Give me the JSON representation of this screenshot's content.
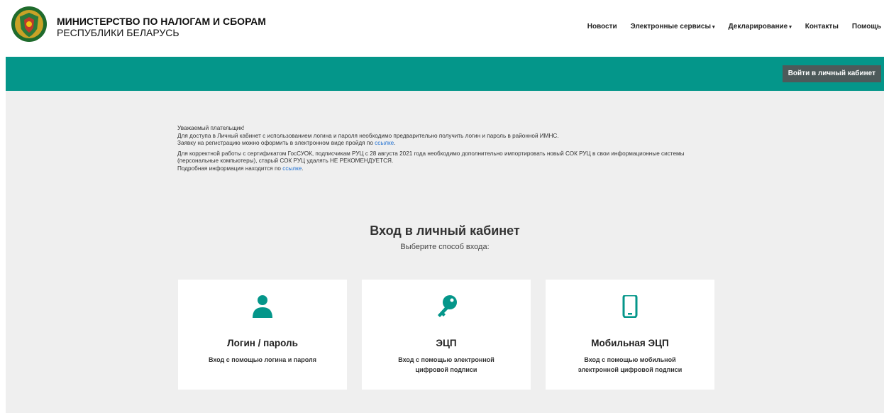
{
  "header": {
    "org_line1": "МИНИСТЕРСТВО ПО НАЛОГАМ И СБОРАМ",
    "org_line2": "РЕСПУБЛИКИ БЕЛАРУСЬ",
    "nav": [
      {
        "label": "Новости"
      },
      {
        "label": "Электронные сервисы",
        "dropdown": "▾"
      },
      {
        "label": "Декларирование",
        "dropdown": "▾"
      },
      {
        "label": "Контакты"
      },
      {
        "label": "Помощь"
      }
    ]
  },
  "banner": {
    "login_button": "Войти в личный кабинет",
    "color": "#04968a"
  },
  "notice": {
    "greeting": "Уважаемый плательщик!",
    "line1": "Для доступа в Личный кабинет с использованием логина и пароля необходимо предварительно получить логин и пароль в районной ИМНС.",
    "line2_prefix": "Заявку на регистрацию можно оформить в электронном виде пройдя по ",
    "link1": "ссылке",
    "para2": "Для корректной работы с сертификатом ГосСУОК, подписчикам РУЦ с 28 августа 2021 года необходимо дополнительно импортировать новый СОК РУЦ в свои информационные системы (персональные компьютеры), старый СОК РУЦ удалять НЕ РЕКОМЕНДУЕТСЯ.",
    "line3_prefix": "Подробная информация находится по ",
    "link2": "ссылке",
    "period": "."
  },
  "login": {
    "title": "Вход в личный кабинет",
    "subtitle": "Выберите способ входа:",
    "methods": [
      {
        "icon": "user-icon",
        "title": "Логин / пароль",
        "desc": "Вход с помощью логина и пароля"
      },
      {
        "icon": "key-icon",
        "title": "ЭЦП",
        "desc": "Вход с помощью электронной цифровой подписи"
      },
      {
        "icon": "mobile-phone-icon",
        "title": "Мобильная ЭЦП",
        "desc": "Вход с помощью мобильной электронной цифровой подписи"
      }
    ],
    "accent": "#04968a"
  }
}
